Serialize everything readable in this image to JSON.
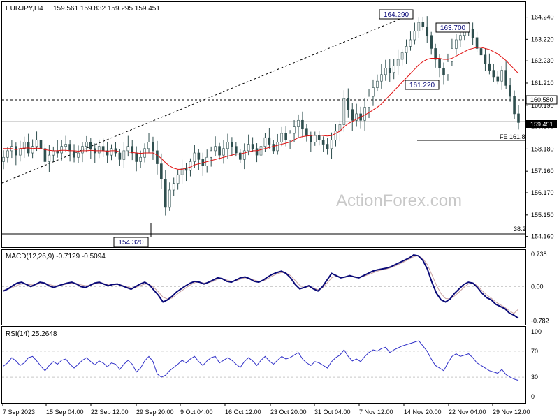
{
  "header": {
    "symbol": "EURJPY,H4",
    "ohlc": "159.561 159.832 159.295 159.451"
  },
  "watermark": "ActionForex.com",
  "colors": {
    "candle": "#2f4f4f",
    "ma": "#e01010",
    "macd": "#0a0a78",
    "signal": "#c8a0a0",
    "rsi": "#3030c8",
    "grid": "#c8c8c8",
    "border": "#000000"
  },
  "chart_data": [
    {
      "type": "candlestick",
      "title": "EURJPY,H4",
      "ylim": [
        153.7,
        164.9
      ],
      "y_ticks": [
        "164.240",
        "163.220",
        "162.230",
        "161.210",
        "160.190",
        "159.200",
        "158.180",
        "157.160",
        "156.170",
        "155.150",
        "154.160"
      ],
      "x_ticks": [
        "7 Sep 2023",
        "15 Sep 04:00",
        "22 Sep 12:00",
        "29 Sep 20:00",
        "9 Oct 04:00",
        "16 Oct 12:00",
        "23 Oct 20:00",
        "31 Oct 04:00",
        "7 Nov 12:00",
        "14 Nov 20:00",
        "22 Nov 04:00",
        "29 Nov 12:00"
      ],
      "ma_name": "",
      "close_series": [
        157.8,
        158.1,
        158.3,
        157.9,
        158.2,
        158.5,
        158.0,
        158.3,
        158.6,
        158.2,
        157.6,
        157.9,
        158.1,
        158.0,
        158.3,
        158.4,
        158.1,
        157.8,
        158.0,
        158.3,
        158.5,
        158.2,
        158.0,
        158.3,
        158.1,
        157.9,
        158.2,
        158.0,
        157.7,
        158.1,
        158.3,
        158.0,
        157.6,
        157.8,
        158.2,
        158.5,
        158.1,
        157.5,
        156.8,
        155.5,
        156.3,
        156.6,
        157.0,
        157.3,
        157.2,
        157.6,
        158.0,
        157.7,
        157.4,
        157.8,
        158.1,
        158.3,
        157.9,
        158.2,
        158.5,
        158.3,
        158.0,
        157.7,
        158.1,
        158.4,
        158.2,
        157.9,
        158.3,
        158.7,
        158.4,
        158.1,
        158.5,
        158.9,
        158.6,
        158.9,
        159.2,
        159.5,
        159.1,
        158.8,
        158.5,
        158.8,
        158.6,
        158.4,
        158.2,
        158.6,
        159.0,
        159.3,
        160.5,
        160.0,
        159.5,
        159.8,
        159.5,
        160.1,
        160.6,
        161.0,
        161.3,
        161.6,
        161.9,
        161.7,
        162.0,
        162.3,
        162.6,
        162.9,
        163.2,
        163.6,
        164.0,
        163.8,
        163.4,
        162.8,
        162.3,
        161.9,
        161.6,
        162.2,
        162.8,
        163.2,
        163.4,
        163.6,
        163.7,
        163.3,
        162.8,
        162.5,
        162.1,
        161.8,
        161.5,
        161.3,
        161.8,
        161.1,
        160.6,
        159.8,
        159.4
      ],
      "ma_series": [
        158.2,
        158.2,
        158.2,
        158.15,
        158.2,
        158.22,
        158.23,
        158.2,
        158.22,
        158.2,
        158.15,
        158.12,
        158.1,
        158.1,
        158.12,
        158.12,
        158.1,
        158.1,
        158.08,
        158.1,
        158.1,
        158.12,
        158.1,
        158.1,
        158.1,
        158.08,
        158.1,
        158.1,
        158.05,
        158.05,
        158.05,
        158.02,
        158.0,
        157.98,
        158.0,
        158.0,
        158.0,
        157.9,
        157.75,
        157.55,
        157.4,
        157.3,
        157.25,
        157.25,
        157.3,
        157.35,
        157.45,
        157.5,
        157.55,
        157.6,
        157.65,
        157.7,
        157.75,
        157.8,
        157.85,
        157.9,
        157.95,
        157.95,
        158.0,
        158.05,
        158.1,
        158.1,
        158.15,
        158.2,
        158.25,
        158.3,
        158.35,
        158.4,
        158.45,
        158.5,
        158.6,
        158.7,
        158.75,
        158.78,
        158.8,
        158.82,
        158.82,
        158.8,
        158.78,
        158.8,
        158.9,
        159.0,
        159.2,
        159.35,
        159.45,
        159.55,
        159.65,
        159.75,
        159.85,
        159.98,
        160.1,
        160.25,
        160.45,
        160.65,
        160.85,
        161.05,
        161.25,
        161.45,
        161.65,
        161.85,
        162.05,
        162.2,
        162.3,
        162.35,
        162.35,
        162.35,
        162.3,
        162.3,
        162.35,
        162.45,
        162.55,
        162.65,
        162.75,
        162.8,
        162.85,
        162.85,
        162.8,
        162.75,
        162.65,
        162.55,
        162.4,
        162.25,
        162.05,
        161.85,
        161.65
      ],
      "annotations": {
        "low": "154.320",
        "high": "164.290",
        "swing_high_2": "163.700",
        "swing_low": "161.220",
        "level_hline": "160.580",
        "current": "159.451",
        "fe_label": "FE 161.8",
        "fibo_label": "38.2"
      }
    },
    {
      "type": "line",
      "title": "MACD(12,26,9) -0.7129 -0.5094",
      "ylim": [
        -0.85,
        0.8
      ],
      "y_ticks": [
        "0.738",
        "0.00",
        "-0.782"
      ],
      "series": [
        {
          "name": "MACD",
          "values": [
            -0.1,
            -0.05,
            0.02,
            0.08,
            0.1,
            0.05,
            0.0,
            0.05,
            0.1,
            0.08,
            0.02,
            -0.02,
            0.02,
            0.05,
            0.08,
            0.1,
            0.06,
            0.0,
            -0.02,
            0.03,
            0.08,
            0.1,
            0.06,
            0.02,
            0.05,
            0.06,
            0.02,
            -0.02,
            -0.06,
            0.0,
            0.06,
            0.1,
            0.04,
            -0.08,
            -0.2,
            -0.35,
            -0.3,
            -0.22,
            -0.12,
            -0.05,
            0.02,
            0.08,
            0.12,
            0.1,
            0.06,
            0.1,
            0.15,
            0.2,
            0.18,
            0.12,
            0.1,
            0.15,
            0.2,
            0.22,
            0.18,
            0.12,
            0.1,
            0.15,
            0.22,
            0.28,
            0.32,
            0.35,
            0.3,
            0.2,
            0.05,
            -0.05,
            -0.02,
            0.02,
            -0.05,
            -0.1,
            0.0,
            0.15,
            0.3,
            0.25,
            0.2,
            0.22,
            0.25,
            0.22,
            0.2,
            0.25,
            0.3,
            0.35,
            0.38,
            0.4,
            0.42,
            0.45,
            0.5,
            0.55,
            0.6,
            0.65,
            0.72,
            0.7,
            0.6,
            0.4,
            0.1,
            -0.15,
            -0.3,
            -0.35,
            -0.28,
            -0.15,
            -0.05,
            0.05,
            0.1,
            0.08,
            -0.02,
            -0.15,
            -0.25,
            -0.3,
            -0.4,
            -0.45,
            -0.5,
            -0.6,
            -0.65,
            -0.72
          ]
        },
        {
          "name": "Signal",
          "values": [
            -0.08,
            -0.06,
            -0.02,
            0.03,
            0.06,
            0.06,
            0.04,
            0.04,
            0.07,
            0.08,
            0.05,
            0.02,
            0.02,
            0.04,
            0.06,
            0.08,
            0.07,
            0.04,
            0.02,
            0.03,
            0.06,
            0.08,
            0.07,
            0.04,
            0.04,
            0.05,
            0.03,
            0.0,
            -0.03,
            -0.02,
            0.02,
            0.06,
            0.05,
            -0.02,
            -0.12,
            -0.24,
            -0.28,
            -0.26,
            -0.18,
            -0.1,
            -0.03,
            0.04,
            0.09,
            0.1,
            0.08,
            0.09,
            0.12,
            0.17,
            0.18,
            0.15,
            0.12,
            0.13,
            0.17,
            0.2,
            0.19,
            0.15,
            0.12,
            0.13,
            0.18,
            0.24,
            0.29,
            0.32,
            0.31,
            0.25,
            0.14,
            0.03,
            -0.02,
            0.0,
            -0.03,
            -0.07,
            -0.03,
            0.08,
            0.2,
            0.24,
            0.22,
            0.22,
            0.23,
            0.23,
            0.21,
            0.23,
            0.27,
            0.31,
            0.35,
            0.38,
            0.4,
            0.43,
            0.47,
            0.52,
            0.57,
            0.62,
            0.68,
            0.7,
            0.64,
            0.5,
            0.27,
            0.03,
            -0.16,
            -0.27,
            -0.28,
            -0.21,
            -0.12,
            -0.02,
            0.06,
            0.08,
            0.02,
            -0.09,
            -0.19,
            -0.26,
            -0.35,
            -0.41,
            -0.47,
            -0.55,
            -0.61,
            -0.51
          ]
        }
      ]
    },
    {
      "type": "line",
      "title": "RSI(14) 25.2648",
      "ylim": [
        0,
        100
      ],
      "y_ticks": [
        "100",
        "70",
        "30",
        "0"
      ],
      "series": [
        {
          "name": "RSI",
          "values": [
            47,
            52,
            60,
            55,
            48,
            52,
            60,
            62,
            55,
            47,
            40,
            48,
            54,
            50,
            56,
            58,
            50,
            44,
            50,
            56,
            60,
            54,
            49,
            55,
            52,
            46,
            52,
            50,
            42,
            50,
            56,
            50,
            38,
            44,
            55,
            62,
            54,
            35,
            30,
            33,
            40,
            45,
            50,
            56,
            52,
            58,
            62,
            54,
            48,
            55,
            60,
            62,
            52,
            56,
            60,
            56,
            50,
            45,
            54,
            60,
            55,
            48,
            56,
            62,
            55,
            50,
            56,
            62,
            58,
            60,
            64,
            68,
            58,
            52,
            48,
            54,
            52,
            48,
            44,
            54,
            60,
            64,
            72,
            62,
            55,
            58,
            54,
            62,
            68,
            72,
            70,
            74,
            76,
            68,
            72,
            75,
            78,
            80,
            82,
            84,
            86,
            78,
            70,
            58,
            48,
            44,
            40,
            52,
            62,
            66,
            62,
            64,
            66,
            60,
            52,
            48,
            44,
            40,
            38,
            36,
            42,
            34,
            30,
            27,
            25
          ]
        }
      ]
    }
  ]
}
